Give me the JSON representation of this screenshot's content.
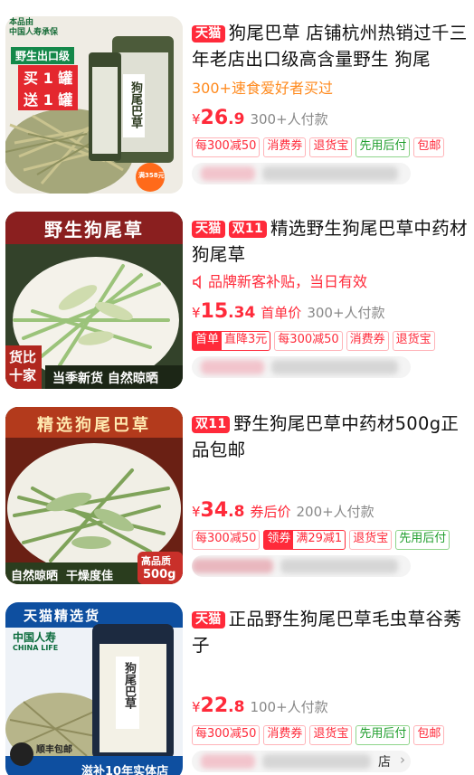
{
  "products": [
    {
      "badges": [
        {
          "text": "天猫",
          "style": "solid"
        }
      ],
      "title": "狗尾巴草 店铺杭州热销过千三年老店出口级高含量野生 狗尾",
      "subline": "300+速食爱好者买过",
      "price_int": "26",
      "price_dec": ".9",
      "currency": "¥",
      "price_label": "",
      "sold": "300+人付款",
      "tags": [
        "每300减50",
        "消费券",
        "退货宝",
        "先用后付",
        "包邮"
      ],
      "image_text": {
        "brand": "本品由\n中国人寿承保",
        "banner1": "野生出口级",
        "banner2": "买 1 罐",
        "banner3": "送 1 罐",
        "jar": "狗尾巴草",
        "sticker": "满358元"
      }
    },
    {
      "badges": [
        {
          "text": "天猫",
          "style": "solid"
        },
        {
          "text": "双11",
          "style": "solid"
        }
      ],
      "title": "精选野生狗尾巴草中药材狗尾草",
      "promo": "品牌新客补贴，当日有效",
      "price_int": "15",
      "price_dec": ".34",
      "currency": "¥",
      "price_label": "首单价",
      "sold": "300+人付款",
      "tags": [
        "首单",
        "直降3元",
        "每300减50",
        "消费券",
        "退货宝"
      ],
      "image_text": {
        "banner": "野生狗尾草",
        "left1": "货比",
        "left2": "十家",
        "bottom": "当季新货 自然晾晒"
      }
    },
    {
      "badges": [
        {
          "text": "双11",
          "style": "solid"
        }
      ],
      "title": "野生狗尾巴草中药材500g正品包邮",
      "price_int": "34",
      "price_dec": ".8",
      "currency": "¥",
      "price_label": "券后价",
      "sold": "200+人付款",
      "tags": [
        "每300减50",
        "领券",
        "满29减1",
        "退货宝",
        "先用后付"
      ],
      "image_text": {
        "banner": "精选狗尾巴草",
        "bottom": "自然晾晒  干燥度佳",
        "badge1": "高品质",
        "badge2": "500g"
      }
    },
    {
      "badges": [
        {
          "text": "天猫",
          "style": "solid"
        }
      ],
      "title": "正品野生狗尾巴草毛虫草谷莠子",
      "price_int": "22",
      "price_dec": ".8",
      "currency": "¥",
      "price_label": "",
      "sold": "100+人付款",
      "tags": [
        "每300减50",
        "消费券",
        "退货宝",
        "先用后付",
        "包邮"
      ],
      "store_name": "店",
      "image_text": {
        "banner": "天猫精选货",
        "brand": "中国人寿",
        "brand_en": "CHINA LIFE",
        "jar": "狗尾巴草",
        "sf": "顺丰包邮",
        "bottom": "滋补10年实体店"
      }
    }
  ],
  "colors": {
    "accent": "#ff2a3a",
    "orange": "#ff8a1e",
    "green": "#1f9e2c"
  }
}
